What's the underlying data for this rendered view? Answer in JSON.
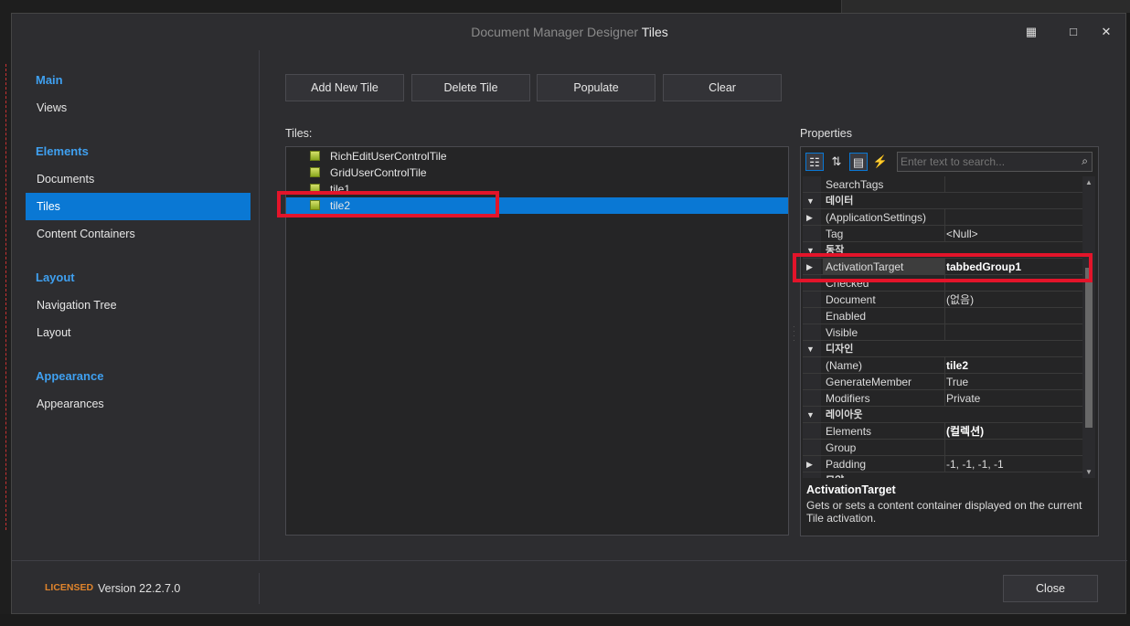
{
  "dialog": {
    "title_prefix": "Document Manager Designer",
    "title_suffix": "Tiles",
    "window_buttons": [
      "▦",
      "□",
      "✕"
    ]
  },
  "nav": {
    "groups": [
      {
        "label": "Main",
        "items": [
          "Views"
        ]
      },
      {
        "label": "Elements",
        "items": [
          "Documents",
          "Tiles",
          "Content Containers"
        ]
      },
      {
        "label": "Layout",
        "items": [
          "Navigation Tree",
          "Layout"
        ]
      },
      {
        "label": "Appearance",
        "items": [
          "Appearances"
        ]
      }
    ],
    "selected": "Tiles"
  },
  "toolbar": {
    "add_label": "Add New Tile",
    "delete_label": "Delete Tile",
    "populate_label": "Populate",
    "clear_label": "Clear"
  },
  "tiles": {
    "label": "Tiles:",
    "items": [
      "RichEditUserControlTile",
      "GridUserControlTile",
      "tile1",
      "tile2"
    ],
    "selected": "tile2"
  },
  "properties": {
    "label": "Properties",
    "search_placeholder": "Enter text to search...",
    "rows": [
      {
        "name": "SearchTags",
        "value": ""
      },
      {
        "name": "데이터",
        "category": true
      },
      {
        "name": "(ApplicationSettings)",
        "value": "",
        "expandable": true
      },
      {
        "name": "Tag",
        "value": "<Null>"
      },
      {
        "name": "동작",
        "category": true
      },
      {
        "name": "ActivationTarget",
        "value": "tabbedGroup1",
        "expandable": true,
        "bold": true
      },
      {
        "name": "Checked",
        "value": ""
      },
      {
        "name": "Document",
        "value": "(없음)"
      },
      {
        "name": "Enabled",
        "value": ""
      },
      {
        "name": "Visible",
        "value": ""
      },
      {
        "name": "디자인",
        "category": true
      },
      {
        "name": "(Name)",
        "value": "tile2",
        "bold": true
      },
      {
        "name": "GenerateMember",
        "value": "True"
      },
      {
        "name": "Modifiers",
        "value": "Private"
      },
      {
        "name": "레이아웃",
        "category": true
      },
      {
        "name": "Elements",
        "value": "(컬렉션)",
        "bold": true
      },
      {
        "name": "Group",
        "value": ""
      },
      {
        "name": "Padding",
        "value": "-1, -1, -1, -1",
        "expandable": true
      },
      {
        "name": "모양",
        "category": true
      }
    ],
    "description_title": "ActivationTarget",
    "description_text": "Gets or sets a content container displayed on the current Tile activation."
  },
  "footer": {
    "licensed": "LICENSED",
    "version": "Version 22.2.7.0",
    "close_label": "Close"
  },
  "colors": {
    "accent": "#0a78d4",
    "highlight_box": "#e3142a",
    "licensed": "#e0842c"
  }
}
